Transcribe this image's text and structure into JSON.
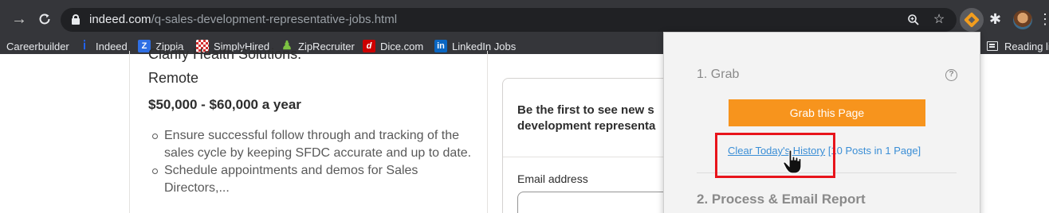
{
  "browser": {
    "url_host": "indeed.com",
    "url_path": "/q-sales-development-representative-jobs.html",
    "icons": [
      "back-arrow-icon",
      "refresh-icon",
      "lock-icon",
      "zoom-icon",
      "star-icon",
      "extension-icon",
      "puzzle-icon",
      "avatar",
      "menu-icon"
    ]
  },
  "bookmarks": {
    "items": [
      {
        "label": "Careerbuilder"
      },
      {
        "label": "Indeed"
      },
      {
        "label": "Zippia"
      },
      {
        "label": "SimplyHired"
      },
      {
        "label": "ZipRecruiter"
      },
      {
        "label": "Dice.com"
      },
      {
        "label": "LinkedIn Jobs"
      }
    ],
    "reading_list": "Reading lis"
  },
  "job": {
    "company": "Clarify Health Solutions.",
    "location": "Remote",
    "salary": "$50,000 - $60,000 a year",
    "bullets": [
      "Ensure successful follow through and tracking of the sales cycle by keeping SFDC accurate and up to date.",
      "Schedule appointments and demos for Sales Directors,..."
    ]
  },
  "signup": {
    "title_line1": "Be the first to see new s",
    "title_line2": "development representa",
    "email_label": "Email address"
  },
  "popup": {
    "section1": "1. Grab",
    "grab_button": "Grab this Page",
    "clear_history": "Clear Today's History",
    "history_info": "[10 Posts in 1 Page]",
    "section2": "2. Process & Email Report",
    "colors": {
      "button": "#f7941d",
      "link": "#3a8ed6",
      "highlight": "#e8141b"
    }
  }
}
